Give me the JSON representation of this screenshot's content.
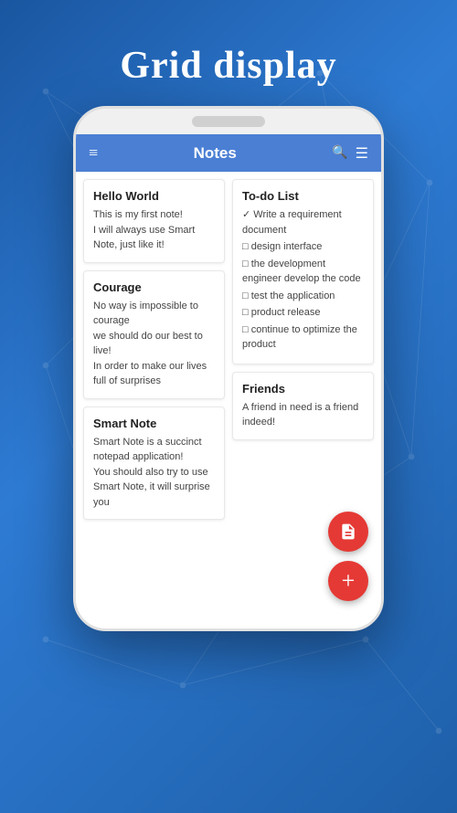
{
  "page": {
    "title": "Grid display",
    "background_color": "#2563b0"
  },
  "app_bar": {
    "title": "Notes",
    "menu_icon": "≡",
    "search_icon": "🔍",
    "filter_icon": "≡"
  },
  "notes": [
    {
      "id": "hello-world",
      "title": "Hello World",
      "body": "This is my first note!\nI will always use Smart Note, just like it!",
      "column": "left"
    },
    {
      "id": "to-do-list",
      "title": "To-do List",
      "body": "✓ Write a requirement document\n□ design interface\n□ the development engineer develop the code\n□ test the application\n□ product release\n□ continue to optimize the product",
      "column": "right"
    },
    {
      "id": "courage",
      "title": "Courage",
      "body": "No way is impossible to courage\nwe should do our best to live!\nIn order to make our lives full of surprises",
      "column": "left"
    },
    {
      "id": "friends",
      "title": "Friends",
      "body": "A friend in need is a friend indeed!",
      "column": "right"
    },
    {
      "id": "smart-note",
      "title": "Smart Note",
      "body": "Smart Note is a succinct notepad application!\nYou should also try to use Smart Note, it will surprise you",
      "column": "left"
    }
  ],
  "fab": {
    "note_icon": "📄",
    "add_icon": "+"
  }
}
